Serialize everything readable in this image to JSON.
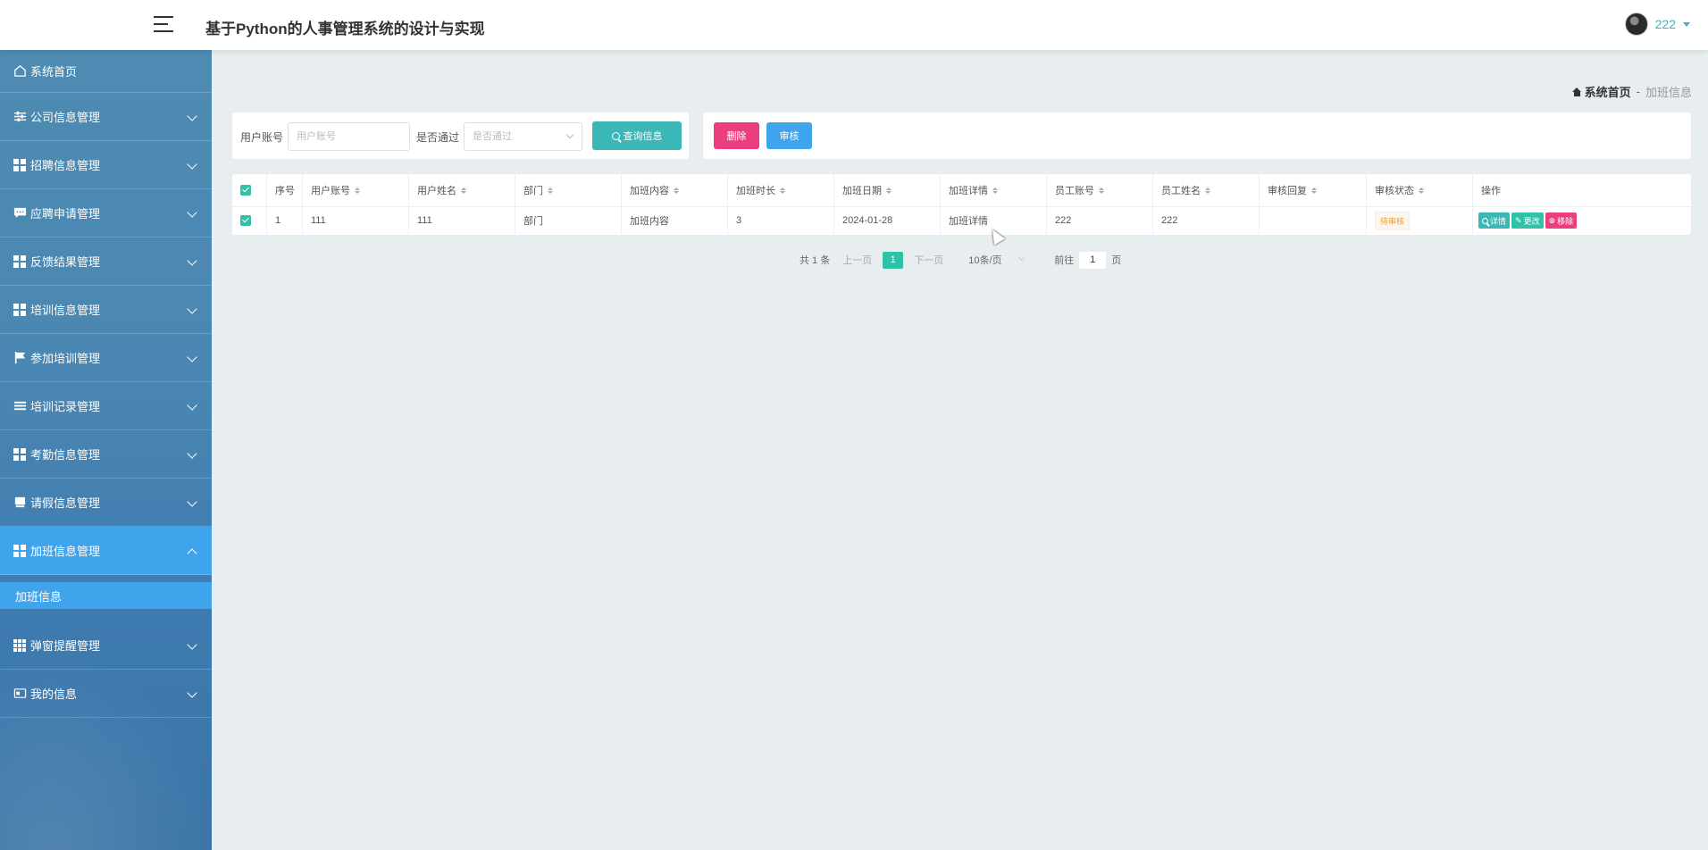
{
  "header": {
    "title": "基于Python的人事管理系统的设计与实现",
    "user_name": "222"
  },
  "sidebar": {
    "items": [
      {
        "label": "系统首页",
        "icon": "home-icon"
      },
      {
        "label": "公司信息管理",
        "icon": "sliders-icon"
      },
      {
        "label": "招聘信息管理",
        "icon": "grid-icon"
      },
      {
        "label": "应聘申请管理",
        "icon": "chat-icon"
      },
      {
        "label": "反馈结果管理",
        "icon": "grid-icon"
      },
      {
        "label": "培训信息管理",
        "icon": "grid-icon"
      },
      {
        "label": "参加培训管理",
        "icon": "flag-icon"
      },
      {
        "label": "培训记录管理",
        "icon": "list-icon"
      },
      {
        "label": "考勤信息管理",
        "icon": "grid-icon"
      },
      {
        "label": "请假信息管理",
        "icon": "monitor-icon"
      },
      {
        "label": "加班信息管理",
        "icon": "grid-icon"
      },
      {
        "label": "弹窗提醒管理",
        "icon": "grid9-icon"
      },
      {
        "label": "我的信息",
        "icon": "card-icon"
      }
    ],
    "active_sub_item": "加班信息"
  },
  "breadcrumb": {
    "home": "系统首页",
    "separator": "-",
    "current": "加班信息"
  },
  "search": {
    "account_label": "用户账号",
    "account_placeholder": "用户账号",
    "passed_label": "是否通过",
    "passed_placeholder": "是否通过",
    "query_button": "查询信息"
  },
  "actions": {
    "delete_button": "删除",
    "review_button": "审核"
  },
  "table": {
    "columns": [
      "序号",
      "用户账号",
      "用户姓名",
      "部门",
      "加班内容",
      "加班时长",
      "加班日期",
      "加班详情",
      "员工账号",
      "员工姓名",
      "审核回复",
      "审核状态",
      "操作"
    ],
    "rows": [
      {
        "index": "1",
        "user_account": "111",
        "user_name": "111",
        "department": "部门",
        "overtime_content": "加班内容",
        "overtime_hours": "3",
        "overtime_date": "2024-01-28",
        "overtime_detail": "加班详情",
        "employee_account": "222",
        "employee_name": "222",
        "review_reply": "",
        "review_status": "待审核"
      }
    ],
    "op_buttons": {
      "detail": "详情",
      "edit": "更改",
      "remove": "移除"
    }
  },
  "pagination": {
    "total": "共 1 条",
    "prev": "上一页",
    "current_page": "1",
    "next": "下一页",
    "page_size": "10条/页",
    "goto_label": "前往",
    "goto_value": "1",
    "page_suffix": "页"
  },
  "colors": {
    "sidebar_bg": "#4a87b2",
    "active_blue": "#3fa4ec",
    "teal": "#3ab7b7",
    "green": "#2fc2a8",
    "pink": "#ea3e7e",
    "warning": "#e6a23c"
  }
}
